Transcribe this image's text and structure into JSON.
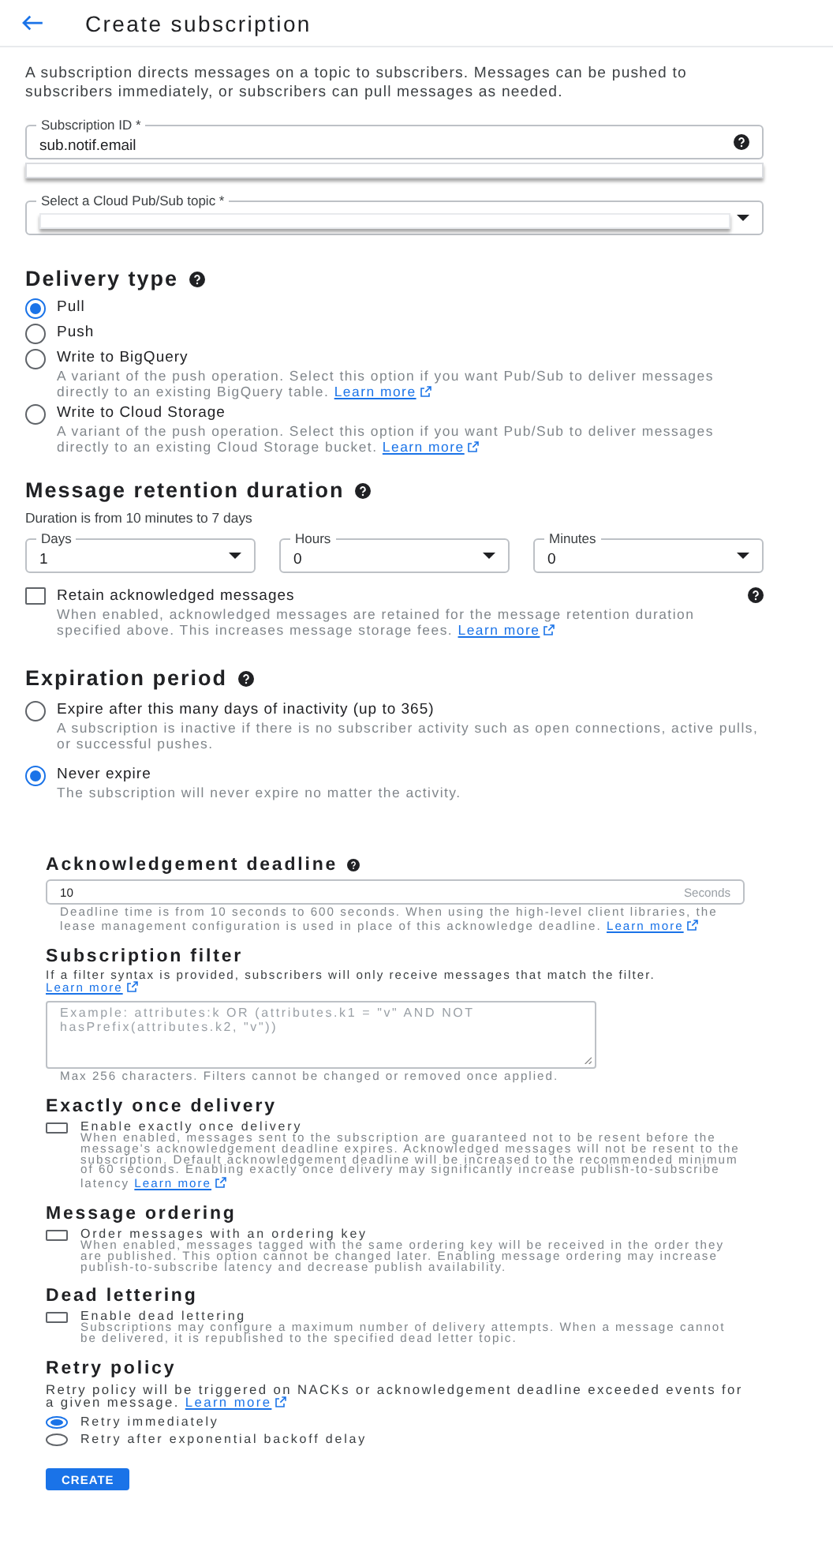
{
  "header": {
    "title": "Create subscription"
  },
  "intro": "A subscription directs messages on a topic to subscribers. Messages can be pushed to subscribers immediately, or subscribers can pull messages as needed.",
  "subscription_id": {
    "label": "Subscription ID *",
    "value": "sub.notif.email"
  },
  "topic": {
    "label": "Select a Cloud Pub/Sub topic *"
  },
  "delivery": {
    "title": "Delivery type",
    "options": [
      {
        "label": "Pull",
        "selected": true
      },
      {
        "label": "Push",
        "selected": false
      },
      {
        "label": "Write to BigQuery",
        "description": "A variant of the push operation. Select this option if you want Pub/Sub to deliver messages directly to an existing BigQuery table.",
        "link": "Learn more",
        "selected": false
      },
      {
        "label": "Write to Cloud Storage",
        "description": "A variant of the push operation. Select this option if you want Pub/Sub to deliver messages directly to an existing Cloud Storage bucket.",
        "link": "Learn more",
        "selected": false
      }
    ]
  },
  "retention": {
    "title": "Message retention duration",
    "hint": "Duration is from 10 minutes to 7 days",
    "fields": [
      {
        "label": "Days",
        "value": "1"
      },
      {
        "label": "Hours",
        "value": "0"
      },
      {
        "label": "Minutes",
        "value": "0"
      }
    ],
    "retain": {
      "label": "Retain acknowledged messages",
      "description": "When enabled, acknowledged messages are retained for the message retention duration specified above. This increases message storage fees.",
      "link": "Learn more",
      "checked": false
    }
  },
  "expiration": {
    "title": "Expiration period",
    "options": [
      {
        "label": "Expire after this many days of inactivity (up to 365)",
        "description": "A subscription is inactive if there is no subscriber activity such as open connections, active pulls, or successful pushes.",
        "selected": false
      },
      {
        "label": "Never expire",
        "description": "The subscription will never expire no matter the activity.",
        "selected": true
      }
    ]
  },
  "ack": {
    "title": "Acknowledgement deadline",
    "value": "10",
    "unit": "Seconds",
    "description": "Deadline time is from 10 seconds to 600 seconds. When using the high-level client libraries, the lease management configuration is used in place of this acknowledge deadline.",
    "link": "Learn more"
  },
  "filter": {
    "title": "Subscription filter",
    "description": "If a filter syntax is provided, subscribers will only receive messages that match the filter.",
    "link": "Learn more",
    "placeholder": "Example: attributes:k OR (attributes.k1 = \"v\" AND NOT hasPrefix(attributes.k2, \"v\"))",
    "note": "Max 256 characters. Filters cannot be changed or removed once applied."
  },
  "options": [
    {
      "title": "Exactly once delivery",
      "label": "Enable exactly once delivery",
      "description": "When enabled, messages sent to the subscription are guaranteed not to be resent before the message's acknowledgement deadline expires. Acknowledged messages will not be resent to the subscription. Default acknowledgement deadline will be increased to the recommended minimum of 60 seconds. Enabling exactly once delivery may significantly increase publish-to-subscribe latency",
      "link": "Learn more",
      "checked": false
    },
    {
      "title": "Message ordering",
      "label": "Order messages with an ordering key",
      "description": "When enabled, messages tagged with the same ordering key will be received in the order they are published. This option cannot be changed later. Enabling message ordering may increase publish-to-subscribe latency and decrease publish availability.",
      "checked": false
    },
    {
      "title": "Dead lettering",
      "label": "Enable dead lettering",
      "description": "Subscriptions may configure a maximum number of delivery attempts. When a message cannot be delivered, it is republished to the specified dead letter topic.",
      "checked": false
    }
  ],
  "retry": {
    "title": "Retry policy",
    "description": "Retry policy will be triggered on NACKs or acknowledgement deadline exceeded events for a given message.",
    "link": "Learn more",
    "options": [
      {
        "label": "Retry immediately",
        "selected": true
      },
      {
        "label": "Retry after exponential backoff delay",
        "selected": false
      }
    ]
  },
  "create_button": "CREATE"
}
